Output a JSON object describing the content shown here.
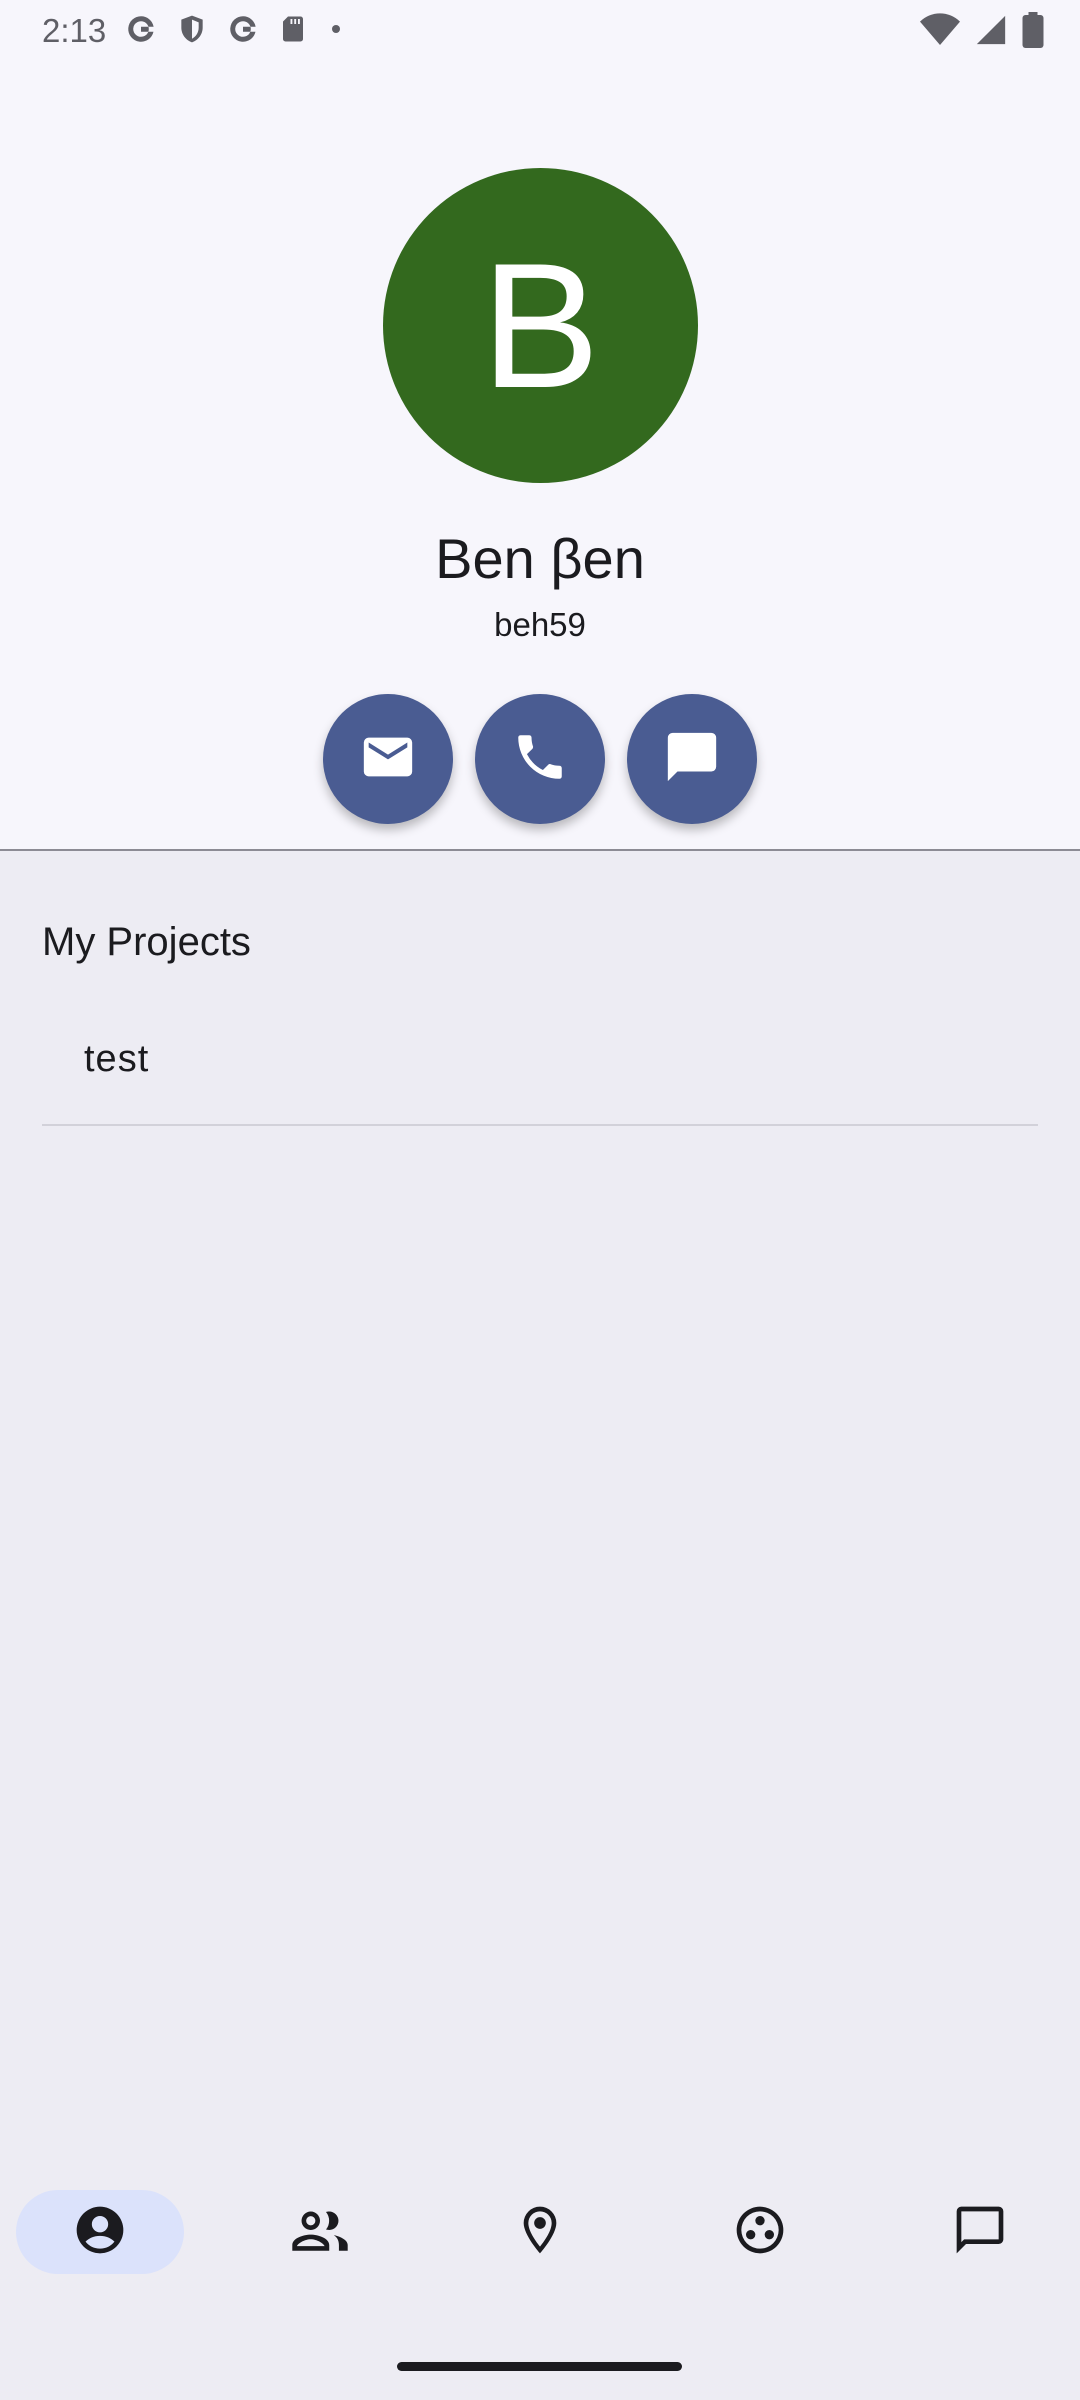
{
  "status_bar": {
    "time": "2:13",
    "left_icons": [
      "google-icon",
      "shield-icon",
      "google-icon",
      "sd-card-icon",
      "dot-icon"
    ],
    "right_icons": [
      "wifi-icon",
      "signal-icon",
      "battery-icon"
    ]
  },
  "profile": {
    "avatar_letter": "B",
    "avatar_color": "#33691e",
    "name": "Ben βen",
    "username": "beh59",
    "actions": [
      "email-icon",
      "phone-icon",
      "message-icon"
    ],
    "action_color": "#4a5c92"
  },
  "projects": {
    "title": "My Projects",
    "items": [
      {
        "label": "test"
      }
    ]
  },
  "bottom_nav": {
    "items": [
      {
        "icon": "account-circle-icon",
        "active": true
      },
      {
        "icon": "people-icon",
        "active": false
      },
      {
        "icon": "location-pin-icon",
        "active": false
      },
      {
        "icon": "projects-icon",
        "active": false
      },
      {
        "icon": "chat-bubble-icon",
        "active": false
      }
    ],
    "active_color": "#dbe2fb"
  }
}
